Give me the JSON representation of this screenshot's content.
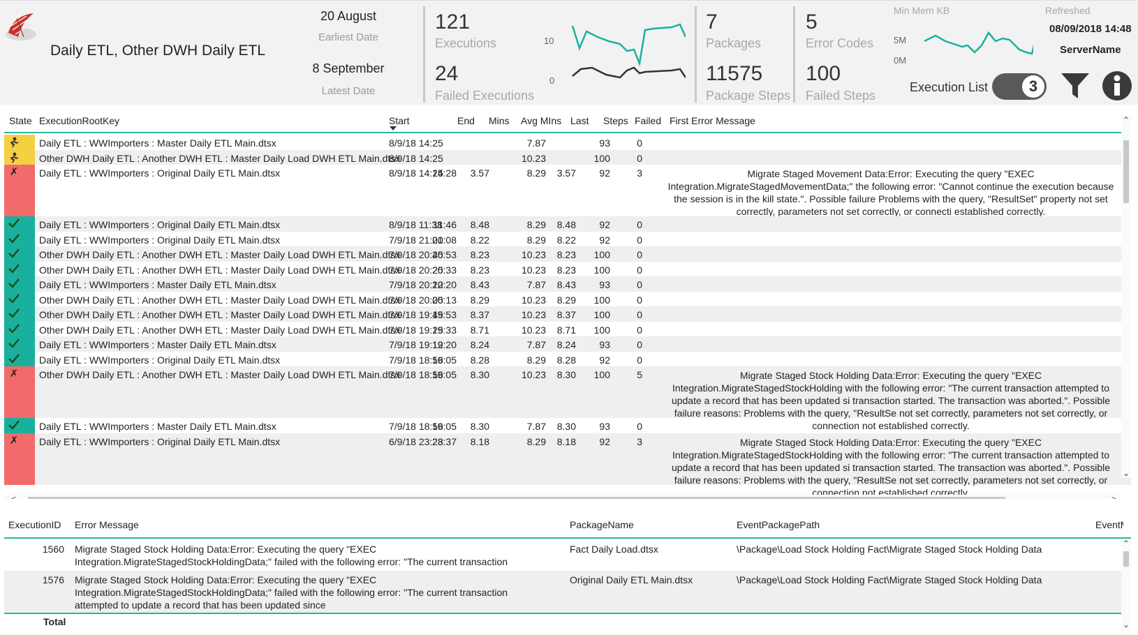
{
  "header": {
    "title": "Daily ETL, Other DWH Daily ETL",
    "earliest_date": "20 August",
    "earliest_caption": "Earliest Date",
    "latest_date": "8 September",
    "latest_caption": "Latest Date",
    "executions": "121",
    "executions_caption": "Executions",
    "failed_executions": "24",
    "failed_executions_caption": "Failed Executions",
    "chart_axis_top": "10",
    "chart_axis_bottom": "0",
    "packages": "7",
    "packages_caption": "Packages",
    "package_steps": "11575",
    "package_steps_caption": "Package Steps",
    "error_codes": "5",
    "error_codes_caption": "Error Codes",
    "failed_steps": "100",
    "failed_steps_caption": "Failed Steps",
    "min_mem_caption": "Min Mem KB",
    "mem_axis_top": "5M",
    "mem_axis_bottom": "0M",
    "refreshed_caption": "Refreshed",
    "refreshed_value": "08/09/2018 14:48",
    "server_name": "ServerName",
    "execution_list_label": "Execution List",
    "toggle_value": "3",
    "accent_color": "#1ab09e"
  },
  "top_table": {
    "columns": {
      "state": "State",
      "root_key": "ExecutionRootKey",
      "start": "Start",
      "end": "End",
      "mins": "Mins",
      "avg_mins": "Avg MIns",
      "last": "Last",
      "steps": "Steps",
      "failed": "Failed",
      "first_error": "First Error Message"
    },
    "rows": [
      {
        "state": "running",
        "key": "Daily ETL : WWImporters : Master Daily ETL Main.dtsx",
        "start": "8/9/18 14:25",
        "end": "",
        "mins": "",
        "avg": "7.87",
        "last": "",
        "steps": "93",
        "failed": "0",
        "error": ""
      },
      {
        "state": "running",
        "key": "Other DWH Daily ETL : Another DWH ETL : Master Daily Load DWH ETL Main.dtsx",
        "start": "8/9/18 14:25",
        "end": "",
        "mins": "",
        "avg": "10.23",
        "last": "",
        "steps": "100",
        "failed": "0",
        "error": ""
      },
      {
        "state": "failed",
        "key": "Daily ETL : WWImporters : Original Daily ETL Main.dtsx",
        "start": "8/9/18 14:25",
        "end": "14:28",
        "mins": "3.57",
        "avg": "8.29",
        "last": "3.57",
        "steps": "92",
        "failed": "3",
        "error": "Migrate Staged Movement Data:Error: Executing the query \"EXEC Integration.MigrateStagedMovementData;\" the following error: \"Cannot continue the execution because the session is in the kill state.\". Possible failure Problems with the query, \"ResultSet\" property not set correctly, parameters not set correctly, or connecti established correctly."
      },
      {
        "state": "ok",
        "key": "Daily ETL : WWImporters : Original Daily ETL Main.dtsx",
        "start": "8/9/18 11:38",
        "end": "11:46",
        "mins": "8.48",
        "avg": "8.29",
        "last": "8.48",
        "steps": "92",
        "failed": "0",
        "error": ""
      },
      {
        "state": "ok",
        "key": "Daily ETL : WWImporters : Original Daily ETL Main.dtsx",
        "start": "7/9/18 21:00",
        "end": "21:08",
        "mins": "8.22",
        "avg": "8.29",
        "last": "8.22",
        "steps": "92",
        "failed": "0",
        "error": ""
      },
      {
        "state": "ok",
        "key": "Other DWH Daily ETL : Another DWH ETL : Master Daily Load DWH ETL Main.dtsx",
        "start": "7/9/18 20:45",
        "end": "20:53",
        "mins": "8.23",
        "avg": "10.23",
        "last": "8.23",
        "steps": "100",
        "failed": "0",
        "error": ""
      },
      {
        "state": "ok",
        "key": "Other DWH Daily ETL : Another DWH ETL : Master Daily Load DWH ETL Main.dtsx",
        "start": "7/9/18 20:25",
        "end": "20:33",
        "mins": "8.23",
        "avg": "10.23",
        "last": "8.23",
        "steps": "100",
        "failed": "0",
        "error": ""
      },
      {
        "state": "ok",
        "key": "Daily ETL : WWImporters : Master Daily ETL Main.dtsx",
        "start": "7/9/18 20:12",
        "end": "20:20",
        "mins": "8.43",
        "avg": "7.87",
        "last": "8.43",
        "steps": "93",
        "failed": "0",
        "error": ""
      },
      {
        "state": "ok",
        "key": "Other DWH Daily ETL : Another DWH ETL : Master Daily Load DWH ETL Main.dtsx",
        "start": "7/9/18 20:05",
        "end": "20:13",
        "mins": "8.29",
        "avg": "10.23",
        "last": "8.29",
        "steps": "100",
        "failed": "0",
        "error": ""
      },
      {
        "state": "ok",
        "key": "Other DWH Daily ETL : Another DWH ETL : Master Daily Load DWH ETL Main.dtsx",
        "start": "7/9/18 19:45",
        "end": "19:53",
        "mins": "8.37",
        "avg": "10.23",
        "last": "8.37",
        "steps": "100",
        "failed": "0",
        "error": ""
      },
      {
        "state": "ok",
        "key": "Other DWH Daily ETL : Another DWH ETL : Master Daily Load DWH ETL Main.dtsx",
        "start": "7/9/18 19:25",
        "end": "19:33",
        "mins": "8.71",
        "avg": "10.23",
        "last": "8.71",
        "steps": "100",
        "failed": "0",
        "error": ""
      },
      {
        "state": "ok",
        "key": "Daily ETL : WWImporters : Master Daily ETL Main.dtsx",
        "start": "7/9/18 19:12",
        "end": "19:20",
        "mins": "8.24",
        "avg": "7.87",
        "last": "8.24",
        "steps": "93",
        "failed": "0",
        "error": ""
      },
      {
        "state": "ok",
        "key": "Daily ETL : WWImporters : Original Daily ETL Main.dtsx",
        "start": "7/9/18 18:56",
        "end": "19:05",
        "mins": "8.28",
        "avg": "8.29",
        "last": "8.28",
        "steps": "92",
        "failed": "0",
        "error": ""
      },
      {
        "state": "failed",
        "key": "Other DWH Daily ETL : Another DWH ETL : Master Daily Load DWH ETL Main.dtsx",
        "start": "7/9/18 18:56",
        "end": "19:05",
        "mins": "8.30",
        "avg": "10.23",
        "last": "8.30",
        "steps": "100",
        "failed": "5",
        "error": "Migrate Staged Stock Holding Data:Error: Executing the query \"EXEC Integration.MigrateStagedStockHolding with the following error: \"The current transaction attempted to update a record that has been updated si transaction started. The transaction was aborted.\". Possible failure reasons: Problems with the query, \"ResultSe not set correctly, parameters not set correctly, or connection not established correctly."
      },
      {
        "state": "ok",
        "key": "Daily ETL : WWImporters : Master Daily ETL Main.dtsx",
        "start": "7/9/18 18:56",
        "end": "19:05",
        "mins": "8.30",
        "avg": "7.87",
        "last": "8.30",
        "steps": "93",
        "failed": "0",
        "error": ""
      },
      {
        "state": "failed",
        "key": "Daily ETL : WWImporters : Original Daily ETL Main.dtsx",
        "start": "6/9/18 23:28",
        "end": "23:37",
        "mins": "8.18",
        "avg": "8.29",
        "last": "8.18",
        "steps": "92",
        "failed": "3",
        "error": "Migrate Staged Stock Holding Data:Error: Executing the query \"EXEC Integration.MigrateStagedStockHolding with the following error: \"The current transaction attempted to update a record that has been updated si transaction started. The transaction was aborted.\". Possible failure reasons: Problems with the query, \"ResultSe not set correctly, parameters not set correctly, or connection not established correctly."
      }
    ]
  },
  "bottom_table": {
    "columns": {
      "execution_id": "ExecutionID",
      "error_message": "Error Message",
      "package_name": "PackageName",
      "event_path": "EventPackagePath",
      "event_m": "EventM"
    },
    "rows": [
      {
        "id": "1560",
        "message": "Migrate Staged Stock Holding Data:Error: Executing the query \"EXEC Integration.MigrateStagedStockHoldingData;\" failed with the following error: \"The current transaction attempted to update a record that has been updated since this transaction started. The transaction was aborted.\". Possible failure reasons: Problems with the query, \"ResultSet\" property not set correctly, parameters not set correctly, or connection not established correctly.",
        "package": "Fact Daily Load.dtsx",
        "path": "\\Package\\Load Stock Holding Fact\\Migrate Staged Stock Holding Data"
      },
      {
        "id": "1576",
        "message": "Migrate Staged Stock Holding Data:Error: Executing the query \"EXEC Integration.MigrateStagedStockHoldingData;\" failed with the following error: \"The current transaction attempted to update a record that has been updated since",
        "package": "Original Daily ETL Main.dtsx",
        "path": "\\Package\\Load Stock Holding Fact\\Migrate Staged Stock Holding Data"
      }
    ],
    "total_label": "Total"
  }
}
